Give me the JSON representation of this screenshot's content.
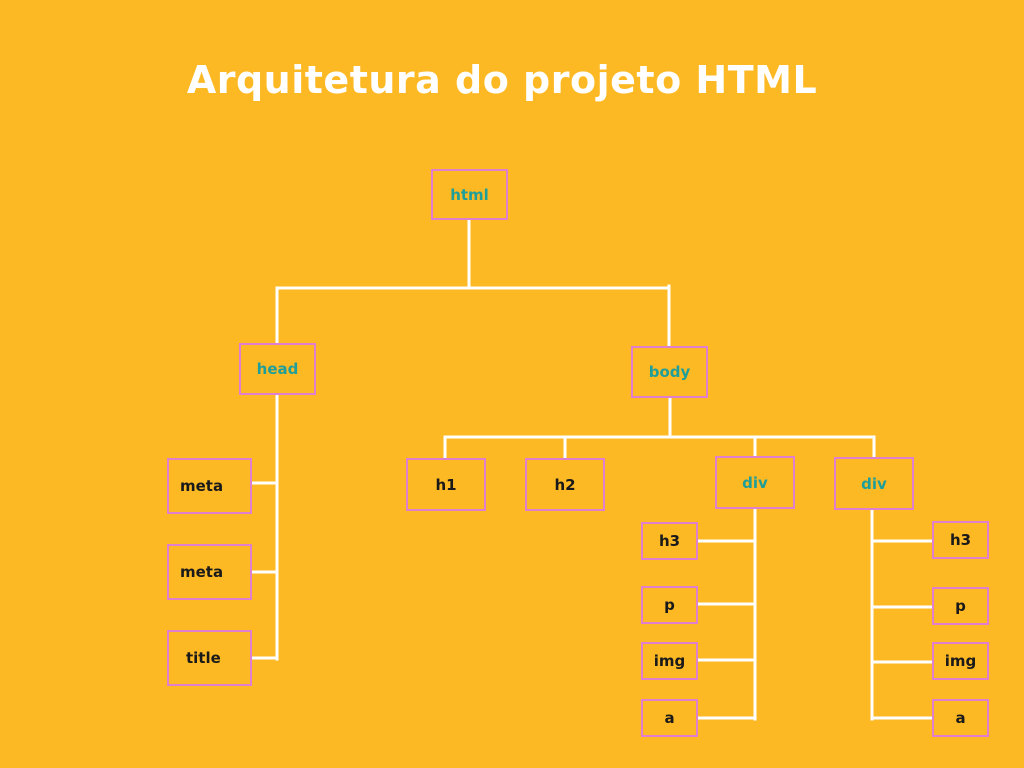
{
  "title": "Arquitetura do projeto HTML",
  "colors": {
    "background": "#FDB924",
    "connector": "#FFFFFF",
    "node_border": "#E07FD0",
    "node_text_dark": "#1a1a1a",
    "node_text_teal": "#1F9E9A",
    "title_text": "#FFFFFF"
  },
  "nodes": {
    "html": "html",
    "head": "head",
    "body": "body",
    "head_children": [
      "meta",
      "meta",
      "title"
    ],
    "body_children": [
      "h1",
      "h2",
      "div",
      "div"
    ],
    "div1_children": [
      "h3",
      "p",
      "img",
      "a"
    ],
    "div2_children": [
      "h3",
      "p",
      "img",
      "a"
    ]
  }
}
